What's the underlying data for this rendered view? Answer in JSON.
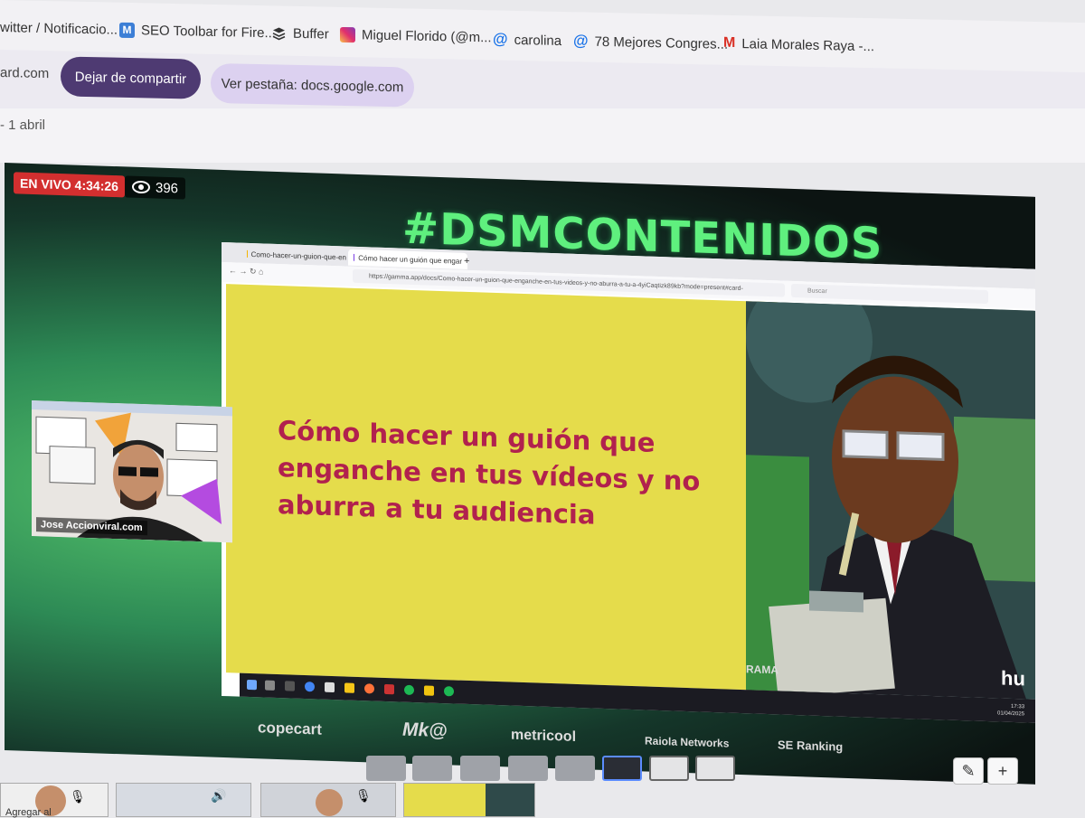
{
  "bookmarks": [
    {
      "label": "witter / Notificacio...",
      "icon": "twitter-icon"
    },
    {
      "label": "SEO Toolbar for Fire...",
      "icon": "m-logo-icon"
    },
    {
      "label": "Buffer",
      "icon": "buffer-stack-icon"
    },
    {
      "label": "Miguel Florido (@m...",
      "icon": "instagram-icon"
    },
    {
      "label": "carolina",
      "icon": "at-sign-icon"
    },
    {
      "label": "78 Mejores Congres...",
      "icon": "at-sign-icon"
    },
    {
      "label": "Laia Morales Raya -...",
      "icon": "gmail-icon"
    }
  ],
  "share_bar": {
    "partial_url": "ard.com",
    "stop_sharing": "Dejar de compartir",
    "view_tab": "Ver pestaña: docs.google.com"
  },
  "header": {
    "date": "- 1 abril"
  },
  "stream": {
    "live_label": "EN VIVO 4:34:26",
    "viewers": "396",
    "hashtag": "#DSMCONTENIDOS",
    "speaker_name": "Jose Accionviral.com"
  },
  "shared_screen": {
    "tabs": [
      "Como-hacer-un-guion-que-en",
      "Cómo hacer un guión que engar"
    ],
    "url": "https://gamma.app/docs/Como-hacer-un-guion-que-enganche-en-tus-videos-y-no-aburra-a-tu-a-4yiCaqtizk89kb?mode=present#card-",
    "search_placeholder": "Buscar",
    "slide_title": "Cómo hacer un guión que enganche en tus vídeos y no aburra a tu audiencia",
    "watermark_left": "RAMA",
    "watermark_right": "hu",
    "clock_time": "17:33",
    "clock_date": "01/04/2025"
  },
  "sponsors": [
    "copecart",
    "Mk@",
    "metricool",
    "Raiola Networks",
    "SE Ranking"
  ],
  "footer": {
    "add_label": "Agregar al"
  },
  "colors": {
    "live_red": "#d32f2f",
    "hashtag_green": "#5ff07e",
    "slide_yellow": "#e5dc4b",
    "slide_text": "#b1214e",
    "stop_button": "#4e3a72"
  }
}
